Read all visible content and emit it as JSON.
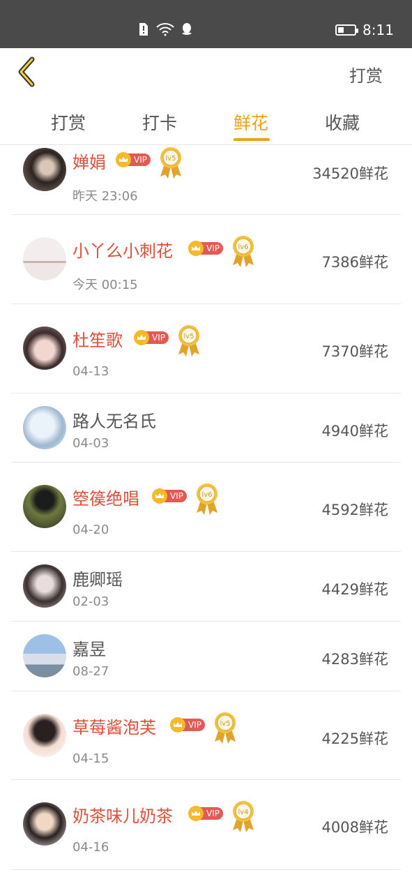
{
  "status_bar": {
    "time": "8:11",
    "icons": [
      "sim-alert-icon",
      "wifi-icon",
      "qq-icon"
    ],
    "battery_level": 0.35
  },
  "header": {
    "right_label": "打赏"
  },
  "tabs": [
    {
      "label": "打赏",
      "active": false
    },
    {
      "label": "打卡",
      "active": false
    },
    {
      "label": "鲜花",
      "active": true
    },
    {
      "label": "收藏",
      "active": false
    }
  ],
  "colors": {
    "accent": "#f0a215",
    "vip_name": "#d9503b",
    "vip_badge": "#e35a55",
    "crown": "#f5b92b"
  },
  "vip_label": "VIP",
  "rows": [
    {
      "name": "婵娟",
      "vip": true,
      "level": "lv5",
      "date": "昨天 23:06",
      "amount": "34520鲜花"
    },
    {
      "name": "小丫么小刺花",
      "vip": true,
      "level": "lv6",
      "date": "今天 00:15",
      "amount": "7386鲜花"
    },
    {
      "name": "杜笙歌",
      "vip": true,
      "level": "lv5",
      "date": "04-13",
      "amount": "7370鲜花"
    },
    {
      "name": "路人无名氏",
      "vip": false,
      "level": "",
      "date": "04-03",
      "amount": "4940鲜花"
    },
    {
      "name": "箜篌绝唱",
      "vip": true,
      "level": "lv6",
      "date": "04-20",
      "amount": "4592鲜花"
    },
    {
      "name": "鹿卿瑶",
      "vip": false,
      "level": "",
      "date": "02-03",
      "amount": "4429鲜花"
    },
    {
      "name": "嘉昱",
      "vip": false,
      "level": "",
      "date": "08-27",
      "amount": "4283鲜花"
    },
    {
      "name": "草莓酱泡芙",
      "vip": true,
      "level": "lv5",
      "date": "04-15",
      "amount": "4225鲜花"
    },
    {
      "name": "奶茶味儿奶茶",
      "vip": true,
      "level": "lv4",
      "date": "04-16",
      "amount": "4008鲜花"
    }
  ]
}
